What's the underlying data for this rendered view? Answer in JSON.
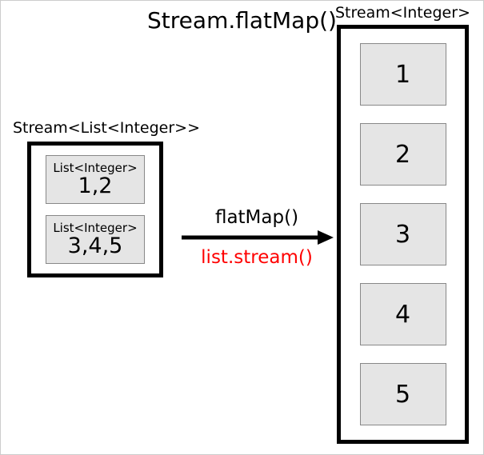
{
  "title": "Stream.flatMap()",
  "left": {
    "label": "Stream<List<Integer>>",
    "items": [
      {
        "type": "List<Integer>",
        "value": "1,2"
      },
      {
        "type": "List<Integer>",
        "value": "3,4,5"
      }
    ]
  },
  "arrow": {
    "top": "flatMap()",
    "bottom": "list.stream()"
  },
  "right": {
    "label": "Stream<Integer>",
    "items": [
      "1",
      "2",
      "3",
      "4",
      "5"
    ]
  }
}
